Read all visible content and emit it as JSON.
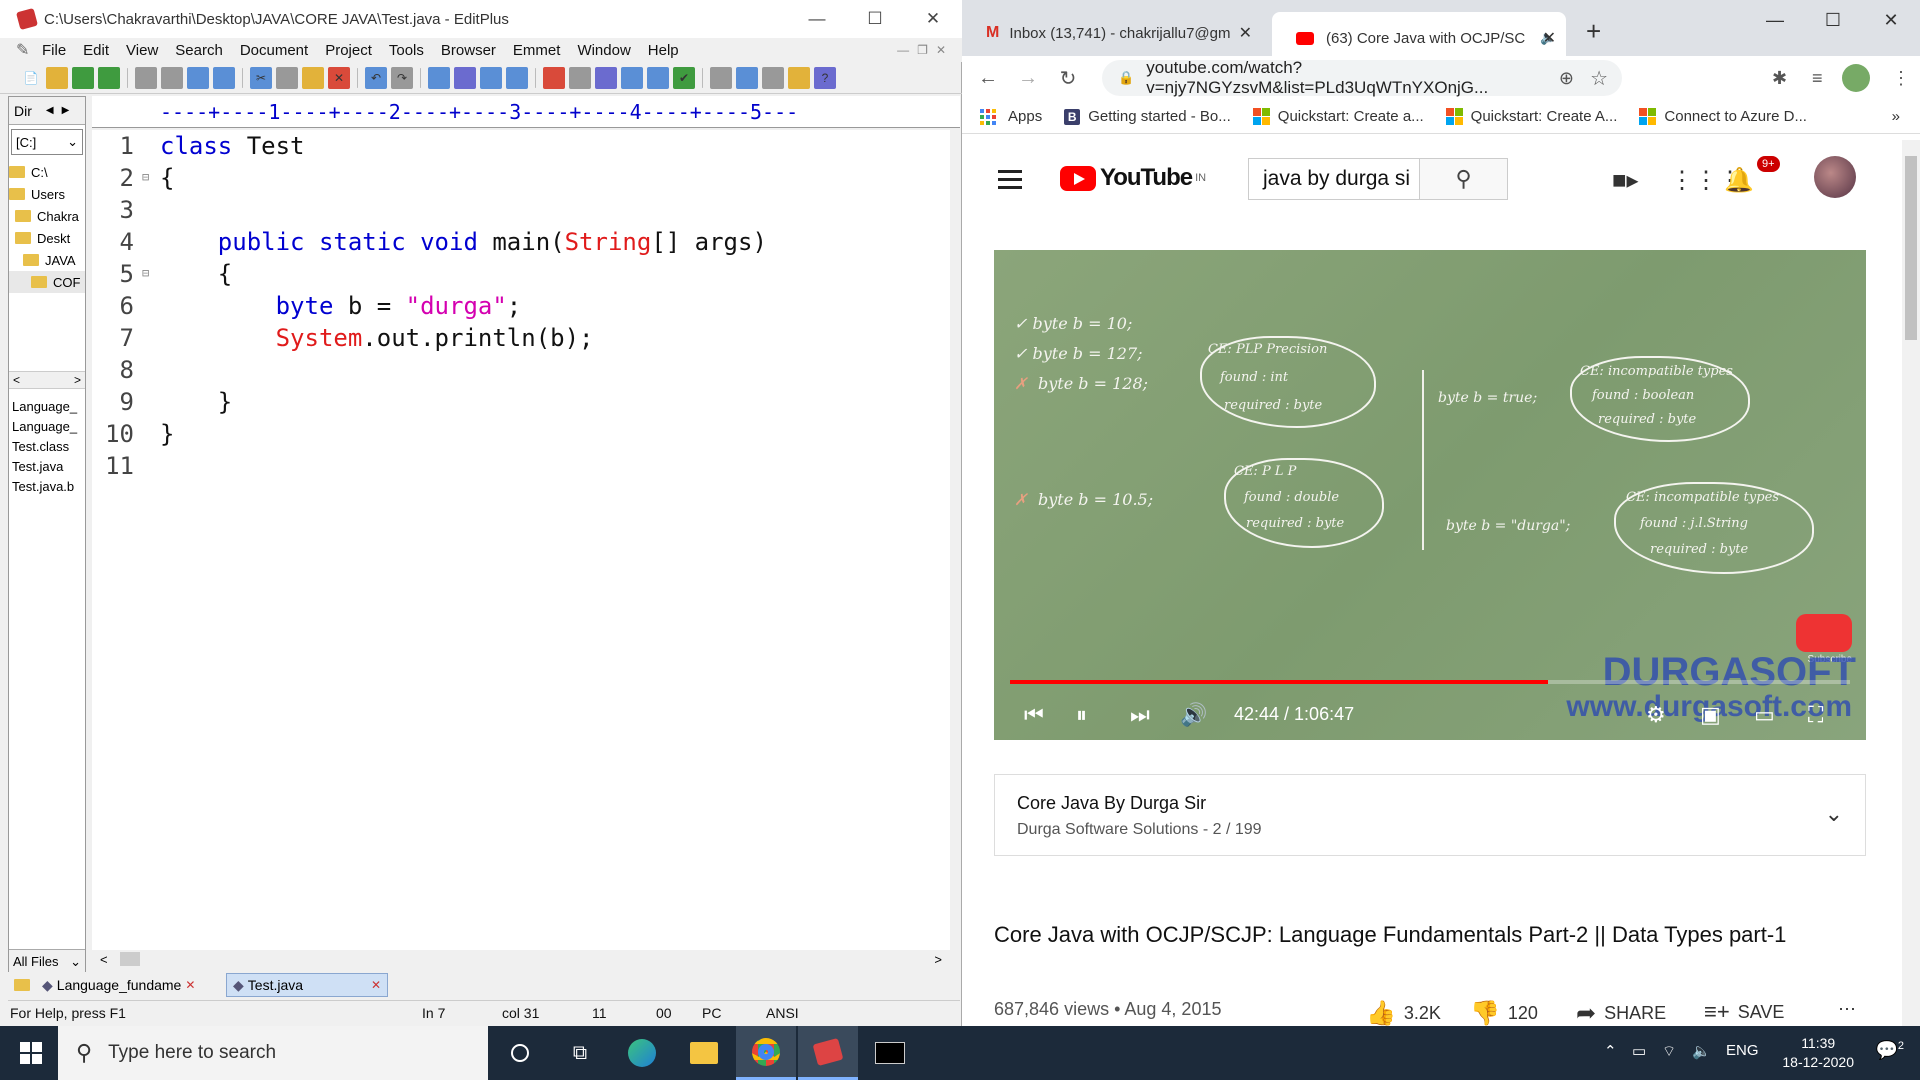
{
  "editplus": {
    "title": "C:\\Users\\Chakravarthi\\Desktop\\JAVA\\CORE JAVA\\Test.java - EditPlus",
    "menu": [
      "File",
      "Edit",
      "View",
      "Search",
      "Document",
      "Project",
      "Tools",
      "Browser",
      "Emmet",
      "Window",
      "Help"
    ],
    "dir_label": "Dir",
    "drive": "[C:]",
    "tree": [
      "C:\\",
      "Users",
      "Chakra",
      "Deskt",
      "JAVA",
      "COF"
    ],
    "files": [
      "Language_",
      "Language_",
      "Test.class",
      "Test.java",
      "Test.java.b"
    ],
    "filter": "All Files",
    "ruler": "----+----1----+----2----+----3----+----4----+----5---",
    "line_numbers": [
      "1",
      "2",
      "3",
      "4",
      "5",
      "6",
      "7",
      "8",
      "9",
      "10",
      "11"
    ],
    "doc_tabs": [
      "Language_fundame",
      "Test.java"
    ],
    "status": {
      "help": "For Help, press F1",
      "line": "In 7",
      "col": "col 31",
      "chars": "11",
      "code": "00",
      "mode": "PC",
      "encoding": "ANSI"
    }
  },
  "chrome": {
    "tabs": [
      {
        "label": "Inbox (13,741) - chakrijallu7@gm",
        "icon": "gmail-icon"
      },
      {
        "label": "(63) Core Java with OCJP/SC",
        "icon": "youtube-icon"
      }
    ],
    "url": "youtube.com/watch?v=njy7NGYzsvM&list=PLd3UqWTnYXOnjG...",
    "bookmarks": [
      "Apps",
      "Getting started - Bo...",
      "Quickstart: Create a...",
      "Quickstart: Create A...",
      "Connect to Azure D..."
    ]
  },
  "youtube": {
    "logo": "YouTube",
    "region": "IN",
    "search_value": "java by durga si",
    "notification_count": "9+",
    "player": {
      "time": "42:44 / 1:06:47",
      "progress": 0.64,
      "watermark": "DURGASOFT",
      "watermark_url": "www.durgasoft.com",
      "subscribe": "Subscribe"
    },
    "playlist": {
      "title": "Core Java By Durga Sir",
      "subtitle": "Durga Software Solutions - 2 / 199"
    },
    "video_title": "Core Java with OCJP/SCJP: Language Fundamentals Part-2 || Data Types part-1",
    "views": "687,846 views • Aug 4, 2015",
    "likes": "3.2K",
    "dislikes": "120",
    "share": "SHARE",
    "save": "SAVE"
  },
  "taskbar": {
    "search_placeholder": "Type here to search",
    "language": "ENG",
    "time": "11:39",
    "date": "18-12-2020",
    "notifications": "2"
  }
}
